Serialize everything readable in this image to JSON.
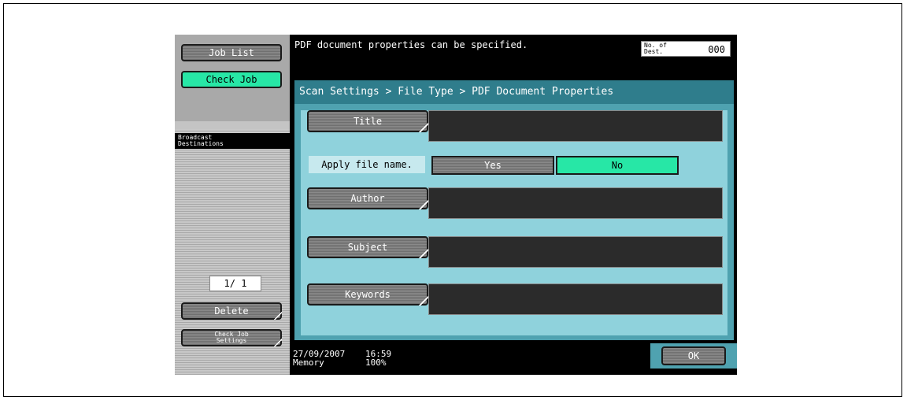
{
  "sidebar": {
    "job_list": "Job List",
    "check_job": "Check Job",
    "broadcast_line1": "Broadcast",
    "broadcast_line2": "Destinations",
    "pager": "1/  1",
    "delete": "Delete",
    "check_job_settings_line1": "Check Job",
    "check_job_settings_line2": "Settings"
  },
  "topbar": {
    "message": "PDF document properties can be specified.",
    "dest_label_line1": "No. of",
    "dest_label_line2": "Dest.",
    "dest_count": "000"
  },
  "panel": {
    "breadcrumb": "Scan Settings > File Type > PDF Document Properties",
    "title_label": "Title",
    "title_value": "",
    "apply_label": "Apply file name.",
    "apply_yes": "Yes",
    "apply_no": "No",
    "apply_selected": "No",
    "author_label": "Author",
    "author_value": "",
    "subject_label": "Subject",
    "subject_value": "",
    "keywords_label": "Keywords",
    "keywords_value": ""
  },
  "footer": {
    "date": "27/09/2007",
    "time": "16:59",
    "memory_label": "Memory",
    "memory_value": "100%",
    "ok": "OK"
  },
  "colors": {
    "selected": "#27e7a6",
    "header": "#2f7d8c",
    "panel": "#4fa2b0",
    "inner": "#8fd2dc"
  }
}
